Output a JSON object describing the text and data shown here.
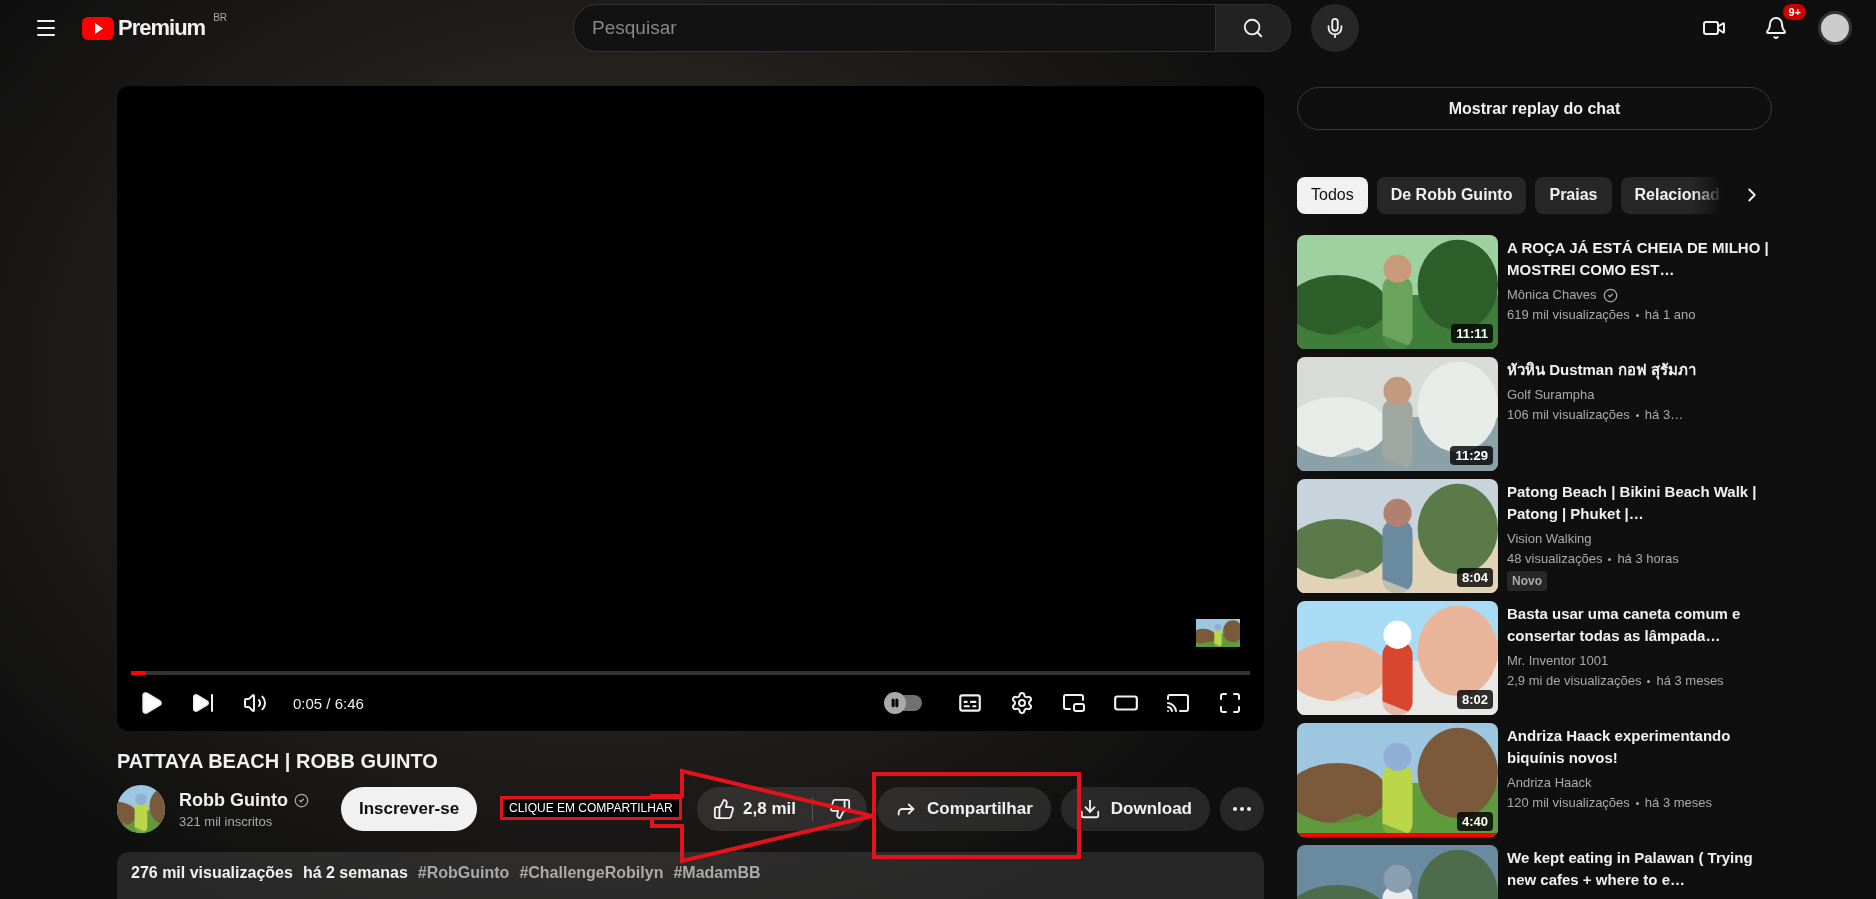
{
  "header": {
    "logo_text": "Premium",
    "region": "BR",
    "search": {
      "placeholder": "Pesquisar"
    },
    "notifications": "9+"
  },
  "player": {
    "progress": {
      "level": 0.013
    },
    "time": "0:05 / 6:46",
    "autoplay": {
      "on": false
    }
  },
  "video": {
    "title": "PATTAYA BEACH | ROBB GUINTO",
    "channel": {
      "name": "Robb Guinto",
      "verified": true,
      "subscribers": "321 mil inscritos"
    },
    "subscribe": "Inscrever-se",
    "likes": "2,8 mil",
    "share": "Compartilhar",
    "download": "Download",
    "description": {
      "views": "276 mil visualizações",
      "date": "há 2 semanas",
      "tags": [
        "#RobGuinto",
        "#ChallengeRobilyn",
        "#MadamBB"
      ]
    }
  },
  "annotation": {
    "label": "CLIQUE EM COMPARTILHAR"
  },
  "sidebar": {
    "chat_button": "Mostrar replay do chat",
    "chips": [
      {
        "label": "Todos",
        "selected": true
      },
      {
        "label": "De Robb Guinto",
        "selected": false
      },
      {
        "label": "Praias",
        "selected": false
      },
      {
        "label": "Relacionad",
        "selected": false
      }
    ],
    "items": [
      {
        "title": "A ROÇA JÁ ESTÁ CHEIA DE MILHO | MOSTREI COMO EST…",
        "channel": "Mônica Chaves",
        "verified": true,
        "views": "619 mil visualizações",
        "age": "há 1 ano",
        "duration": "11:11"
      },
      {
        "title": "หัวหิน Dustman กอฟ สุรัมภา",
        "channel": "Golf Surampha",
        "verified": false,
        "views": "106 mil visualizações",
        "age": "há 3…",
        "duration": "11:29"
      },
      {
        "title": "Patong Beach | Bikini Beach Walk | Patong | Phuket |…",
        "channel": "Vision Walking",
        "verified": false,
        "views": "48 visualizações",
        "age": "há 3 horas",
        "duration": "8:04",
        "badge": "Novo"
      },
      {
        "title": "Basta usar uma caneta comum e consertar todas as lâmpada…",
        "channel": "Mr. Inventor 1001",
        "verified": false,
        "views": "2,9 mi de visualizações",
        "age": "há 3 meses",
        "duration": "8:02"
      },
      {
        "title": "Andriza Haack experimentando biquínis novos!",
        "channel": "Andriza Haack",
        "verified": false,
        "views": "120 mil visualizações",
        "age": "há 3 meses",
        "duration": "4:40",
        "level": 1
      },
      {
        "title": "We kept eating in Palawan ( Trying new cafes + where to e…"
      }
    ]
  }
}
